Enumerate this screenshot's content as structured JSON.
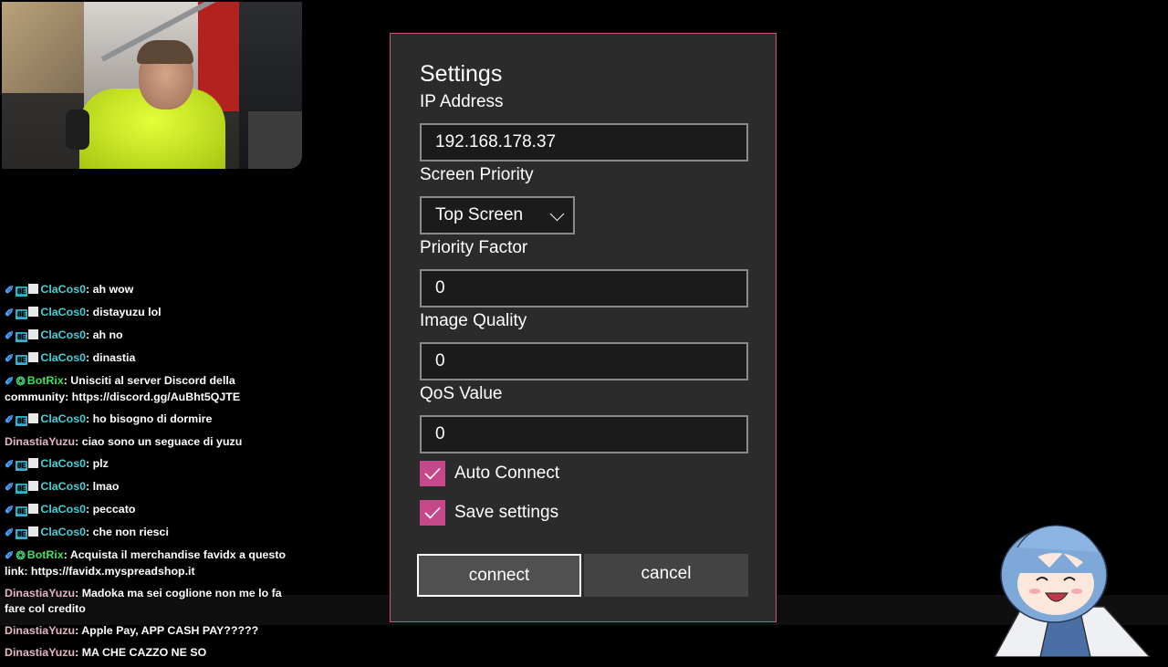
{
  "chat": [
    {
      "badges": [
        "pin",
        "vip",
        "sub"
      ],
      "user": "ClaCos0",
      "user_class": "u-cla",
      "text": "ah wow"
    },
    {
      "badges": [
        "pin",
        "vip",
        "sub"
      ],
      "user": "ClaCos0",
      "user_class": "u-cla",
      "text": "distayuzu lol"
    },
    {
      "badges": [
        "pin",
        "vip",
        "sub"
      ],
      "user": "ClaCos0",
      "user_class": "u-cla",
      "text": "ah no"
    },
    {
      "badges": [
        "pin",
        "vip",
        "sub"
      ],
      "user": "ClaCos0",
      "user_class": "u-cla",
      "text": "dinastia"
    },
    {
      "badges": [
        "pin",
        "bot"
      ],
      "user": "BotRix",
      "user_class": "u-bot",
      "text": "Unisciti al server Discord della community: https://discord.gg/AuBht5QJTE"
    },
    {
      "badges": [
        "pin",
        "vip",
        "sub"
      ],
      "user": "ClaCos0",
      "user_class": "u-cla",
      "text": "ho bisogno di dormire"
    },
    {
      "badges": [],
      "user": "DinastiaYuzu",
      "user_class": "u-din",
      "text": "ciao sono un seguace di yuzu"
    },
    {
      "badges": [
        "pin",
        "vip",
        "sub"
      ],
      "user": "ClaCos0",
      "user_class": "u-cla",
      "text": "plz"
    },
    {
      "badges": [
        "pin",
        "vip",
        "sub"
      ],
      "user": "ClaCos0",
      "user_class": "u-cla",
      "text": "lmao"
    },
    {
      "badges": [
        "pin",
        "vip",
        "sub"
      ],
      "user": "ClaCos0",
      "user_class": "u-cla",
      "text": "peccato"
    },
    {
      "badges": [
        "pin",
        "vip",
        "sub"
      ],
      "user": "ClaCos0",
      "user_class": "u-cla",
      "text": "che non riesci"
    },
    {
      "badges": [
        "pin",
        "bot"
      ],
      "user": "BotRix",
      "user_class": "u-bot",
      "text": "Acquista il merchandise favidx a questo link: https://favidx.myspreadshop.it"
    },
    {
      "badges": [],
      "user": "DinastiaYuzu",
      "user_class": "u-din",
      "text": "Madoka ma sei coglione non me lo fa fare col credito"
    },
    {
      "badges": [],
      "user": "DinastiaYuzu",
      "user_class": "u-din",
      "text": "Apple Pay, APP CASH PAY?????"
    },
    {
      "badges": [],
      "user": "DinastiaYuzu",
      "user_class": "u-din",
      "text": "MA CHE CAZZO NE SO"
    }
  ],
  "badge_vip_text": "8E",
  "settings": {
    "title": "Settings",
    "ip_label": "IP Address",
    "ip_value": "192.168.178.37",
    "screen_priority_label": "Screen Priority",
    "screen_priority_value": "Top Screen",
    "priority_factor_label": "Priority Factor",
    "priority_factor_value": "0",
    "image_quality_label": "Image Quality",
    "image_quality_value": "0",
    "qos_label": "QoS Value",
    "qos_value": "0",
    "auto_connect_label": "Auto Connect",
    "auto_connect_checked": true,
    "save_settings_label": "Save settings",
    "save_settings_checked": true,
    "connect_label": "connect",
    "cancel_label": "cancel"
  },
  "colors": {
    "accent": "#c7488a",
    "dialog_bg": "#2b2b2b",
    "dialog_border": "#d0508a",
    "user_clacos": "#3fd2d9",
    "user_botrix": "#3fe05a",
    "user_dinastia": "#e6b5c3"
  }
}
